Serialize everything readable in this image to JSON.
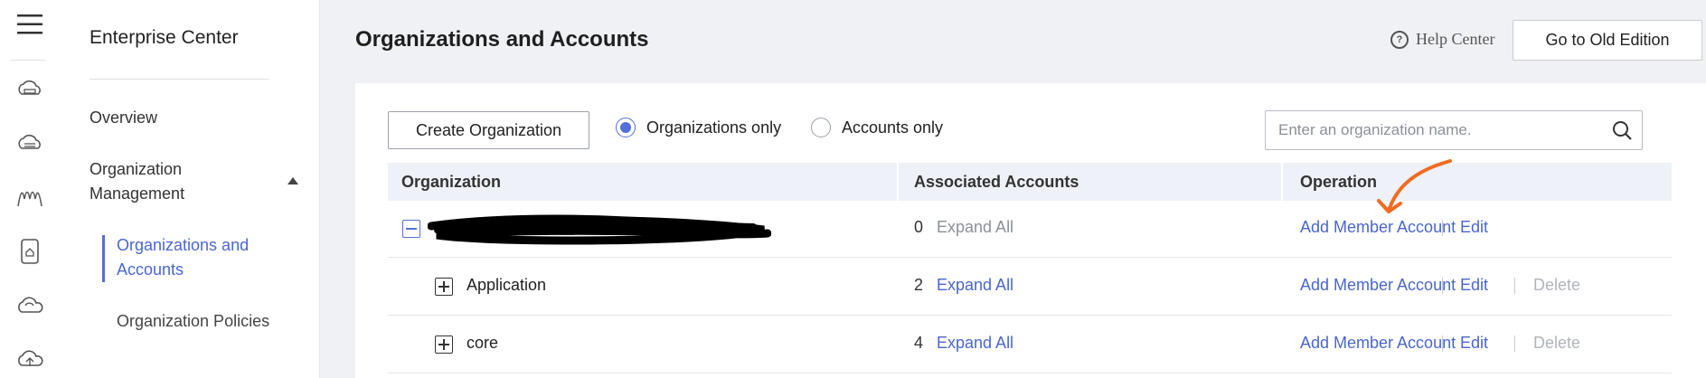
{
  "sidebar": {
    "title": "Enterprise Center",
    "items": [
      {
        "label": "Overview"
      },
      {
        "label": "Organization Management"
      }
    ],
    "subitems": [
      {
        "label": "Organizations and Accounts",
        "active": true
      },
      {
        "label": "Organization Policies",
        "active": false
      }
    ]
  },
  "rail_icons": [
    "menu-icon",
    "cloud-server-icon",
    "database-icon",
    "monitoring-icon",
    "storage-device-icon",
    "cloud-icon",
    "cloud-upload-icon"
  ],
  "page": {
    "title": "Organizations and Accounts",
    "help_label": "Help Center",
    "help_icon": "?",
    "old_edition_label": "Go to Old Edition"
  },
  "toolbar": {
    "create_label": "Create Organization",
    "radio_orgs": "Organizations only",
    "radio_accounts": "Accounts only",
    "selected_radio": "Organizations only",
    "search_placeholder": "Enter an organization name."
  },
  "table": {
    "columns": [
      "Organization",
      "Associated Accounts",
      "Operation"
    ],
    "rows": [
      {
        "name": "",
        "redacted": true,
        "expanded": true,
        "count": "0",
        "expand_label": "Expand All",
        "expand_enabled": false,
        "add_label": "Add Member Account",
        "edit_label": "Edit",
        "delete_label": ""
      },
      {
        "name": "Application",
        "redacted": false,
        "expanded": false,
        "count": "2",
        "expand_label": "Expand All",
        "expand_enabled": true,
        "add_label": "Add Member Account",
        "edit_label": "Edit",
        "delete_label": "Delete"
      },
      {
        "name": "core",
        "redacted": false,
        "expanded": false,
        "count": "4",
        "expand_label": "Expand All",
        "expand_enabled": true,
        "add_label": "Add Member Account",
        "edit_label": "Edit",
        "delete_label": "Delete"
      }
    ]
  },
  "colors": {
    "accent": "#5470d6",
    "link": "#4a66cf",
    "annotation_arrow": "#f26b21",
    "disabled": "#b0b4bc"
  }
}
